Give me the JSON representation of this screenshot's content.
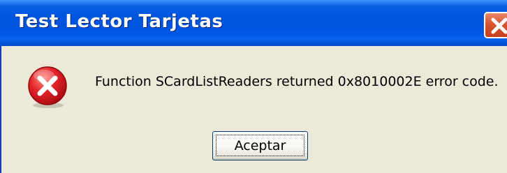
{
  "window": {
    "title": "Test Lector Tarjetas",
    "close_icon": "close-icon"
  },
  "dialog": {
    "icon": "error-icon",
    "message": "Function SCardListReaders returned 0x8010002E error code.",
    "ok_label": "Aceptar"
  },
  "colors": {
    "titlebar": "#0053dc",
    "dialog_background": "#ece9d8",
    "close_button": "#d9542f",
    "error_icon": "#d4111a"
  }
}
